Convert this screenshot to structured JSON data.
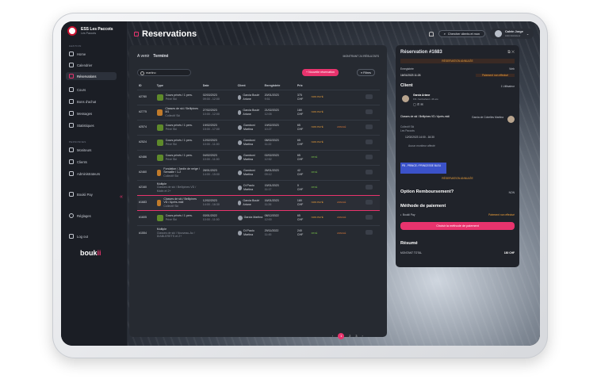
{
  "brand": {
    "name": "ESS Les Paccots",
    "sub": "Les Paccots"
  },
  "sidebar": {
    "section_general": "GESTION",
    "items": [
      {
        "label": "Home",
        "icon": "home-icon"
      },
      {
        "label": "Calendrier",
        "icon": "calendar-icon"
      },
      {
        "label": "Réservations",
        "icon": "reservations-icon"
      },
      {
        "label": "Cours",
        "icon": "courses-icon"
      },
      {
        "label": "Bons d'achat",
        "icon": "voucher-icon"
      },
      {
        "label": "Messages",
        "icon": "message-icon"
      },
      {
        "label": "Statistiques",
        "icon": "stats-icon"
      }
    ],
    "section_people": "PERSONNES",
    "people": [
      {
        "label": "Moniteurs",
        "icon": "instructor-icon"
      },
      {
        "label": "Clients",
        "icon": "clients-icon"
      },
      {
        "label": "Administrateurs",
        "icon": "admin-icon"
      }
    ],
    "boukii_pay": "Boukii Pay",
    "settings": "Réglages",
    "logout": "Log out",
    "logo_a": "bouk",
    "logo_b": "ii"
  },
  "header": {
    "title": "Reservations",
    "search_label": "Chercher clients et mon",
    "user_name": "Calvin Jorge",
    "user_role": "Administrateur"
  },
  "list": {
    "tab_upcoming": "A venir",
    "tab_done": "Terminé",
    "count": "MONTRANT 24 RÉSULTATS",
    "search_value": "martino",
    "new_button": "+ Nouvelle réservation",
    "filters_button": "Filtres",
    "columns": [
      "ID",
      "Type",
      "Date",
      "Client",
      "Enregistrée",
      "Prix"
    ],
    "rows": [
      {
        "id": "#2780",
        "type": "Cours privés / 1 pers.",
        "type_sub": "Privé Ski",
        "date": "02/03/2023",
        "time": "09:00 - 12:00",
        "client": "Garcia Boulé Ariane",
        "reg": "20/01/2023",
        "reg_t": "9:51",
        "price": "375",
        "cur": "CHF",
        "paid": "NON PAYÉ",
        "paidcls": "paid-no",
        "status": "",
        "tic": ""
      },
      {
        "id": "#2775",
        "type": "Classes de ski / Bellipines M1",
        "type_sub": "Collectif Ski",
        "date": "27/02/2023",
        "time": "10:00 - 12:00",
        "client": "Garcia Boulé Ariane",
        "reg": "21/02/2023",
        "reg_t": "12:05",
        "price": "180",
        "cur": "CHF",
        "paid": "NON PAYÉ",
        "paidcls": "paid-no",
        "status": "",
        "tic": "orange"
      },
      {
        "id": "#2574",
        "type": "Cours privés / 1 pers.",
        "type_sub": "Privé Ski",
        "date": "19/02/2023",
        "time": "15:00 - 17:00",
        "client": "Gamboni Martina",
        "reg": "19/02/2023",
        "reg_t": "10:27",
        "price": "65",
        "cur": "CHF",
        "paid": "NON PAYÉ",
        "paidcls": "paid-no",
        "status": "ANNULÉ",
        "tic": ""
      },
      {
        "id": "#2524",
        "type": "Cours privés / 1 pers.",
        "type_sub": "Privé Ski",
        "date": "12/02/2023",
        "time": "10:00 - 11:00",
        "client": "Gamboni Martina",
        "reg": "08/02/2023",
        "reg_t": "11:22",
        "price": "65",
        "cur": "CHF",
        "paid": "NON PAYÉ",
        "paidcls": "paid-no",
        "status": "",
        "tic": ""
      },
      {
        "id": "#2486",
        "type": "Cours privés / 1 pers.",
        "type_sub": "Privé Ski",
        "date": "04/02/2023",
        "time": "10:00 - 11:00",
        "client": "Gamboni Martina",
        "reg": "02/02/2023",
        "reg_t": "12:52",
        "price": "65",
        "cur": "CHF",
        "paid": "PAYÉ",
        "paidcls": "paid-yes",
        "status": "",
        "tic": ""
      },
      {
        "id": "#2460",
        "type": "Fondation / Jardin de neige / Semaille / 1-2",
        "type_sub": "Collectif Ski",
        "date": "28/01/2023",
        "time": "14:00 - 15:00",
        "client": "Gamboni Martina",
        "reg": "26/01/2023",
        "reg_t": "09:12",
        "price": "42",
        "cur": "CHF",
        "paid": "PAYÉ",
        "paidcls": "paid-yes",
        "status": "",
        "tic": "orange"
      },
      {
        "id": "#2160",
        "type": "Multiple",
        "type_sub": "Classes de ski / Bellipines VD / Matin et 2+",
        "date": "",
        "time": "",
        "client": "Di Paolo Martina",
        "reg": "15/01/2023",
        "reg_t": "11:17",
        "price": "0",
        "cur": "CHF",
        "paid": "PAYÉ",
        "paidcls": "paid-yes",
        "status": "",
        "tic": "none"
      },
      {
        "id": "#1683",
        "type": "Classes de ski / Bellipines VD / Après-midi",
        "type_sub": "Collectif Ski",
        "date": "12/02/2023",
        "time": "14:00 - 16:30",
        "client": "Garcia Boulé Ariane",
        "reg": "16/01/2023",
        "reg_t": "11:26",
        "price": "180",
        "cur": "CHF",
        "paid": "NON PAYÉ",
        "paidcls": "paid-no",
        "status": "ANNULÉ",
        "tic": "orange",
        "sel": true
      },
      {
        "id": "#1605",
        "type": "Cours privés / 1 pers.",
        "type_sub": "Privé Ski",
        "date": "03/01/2022",
        "time": "10:00 - 11:00",
        "client": "Garcia Martina",
        "reg": "08/12/2022",
        "reg_t": "12:00",
        "price": "65",
        "cur": "CHF",
        "paid": "NON PAYÉ",
        "paidcls": "paid-no",
        "status": "ANNULÉ",
        "tic": ""
      },
      {
        "id": "#1554",
        "type": "Multiple",
        "type_sub": "Classes de ski / Nouveau-Av / DIABLERETS et 2+",
        "date": "",
        "time": "",
        "client": "Di Paolo Martina",
        "reg": "29/11/2022",
        "reg_t": "11:45",
        "price": "240",
        "cur": "CHF",
        "paid": "PAYÉ",
        "paidcls": "paid-yes",
        "status": "ANNULÉ",
        "tic": "none"
      }
    ],
    "pager": [
      "‹",
      "1",
      "2",
      "3",
      "›"
    ]
  },
  "detail": {
    "title": "Réservation #1683",
    "cancelled": "RÉSERVATION ANNULÉE",
    "registered_label": "Enregistrée",
    "registered_value": "Web",
    "date": "16/01/2023 11:26",
    "payment_status": "Paiement non effectué",
    "client_h": "Client",
    "client_count": "1 Utilisateur",
    "client_name": "Garcia Ariane",
    "client_sub": "FR • Switzerland • 46 ans",
    "course": "Classes de ski / Bellipines VD / Après-midi",
    "course_sub": "Collectif Ski",
    "course_place": "Les Paccots",
    "instructor": "Garcia de Cobelles Martina",
    "course_time": "12/02/2023 14:00 - 16:30",
    "no_monitor": "Aucun moniteur affecté",
    "level_badge": "P8 - PRINCE / PRINCESSE BLEU",
    "cancelled2": "RÉSERVATION ANNULÉE",
    "refund_h": "Option Remboursement?",
    "refund_v": "NON",
    "pay_h": "Méthode de paiement",
    "pay_method": "Boukii Pay",
    "pay_status": "Paiement non effectué",
    "pay_button": "Choisir la méthode de paiement",
    "summary_h": "Résumé",
    "total_label": "MONTANT TOTAL",
    "total_value": "180 CHF"
  }
}
